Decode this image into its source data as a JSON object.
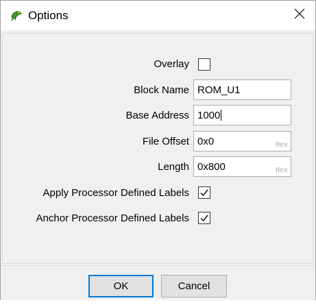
{
  "window": {
    "title": "Options",
    "icon": "green-frog-icon",
    "close_icon": "close-icon"
  },
  "form": {
    "overlay": {
      "label": "Overlay",
      "checked": false
    },
    "block_name": {
      "label": "Block Name",
      "value": "ROM_U1"
    },
    "base_address": {
      "label": "Base Address",
      "value": "1000"
    },
    "file_offset": {
      "label": "File Offset",
      "value": "0x0",
      "suffix": "Hex"
    },
    "length": {
      "label": "Length",
      "value": "0x800",
      "suffix": "Hex"
    },
    "apply_labels": {
      "label": "Apply Processor Defined Labels",
      "checked": true
    },
    "anchor_labels": {
      "label": "Anchor Processor Defined Labels",
      "checked": true
    }
  },
  "buttons": {
    "ok": "OK",
    "cancel": "Cancel"
  }
}
